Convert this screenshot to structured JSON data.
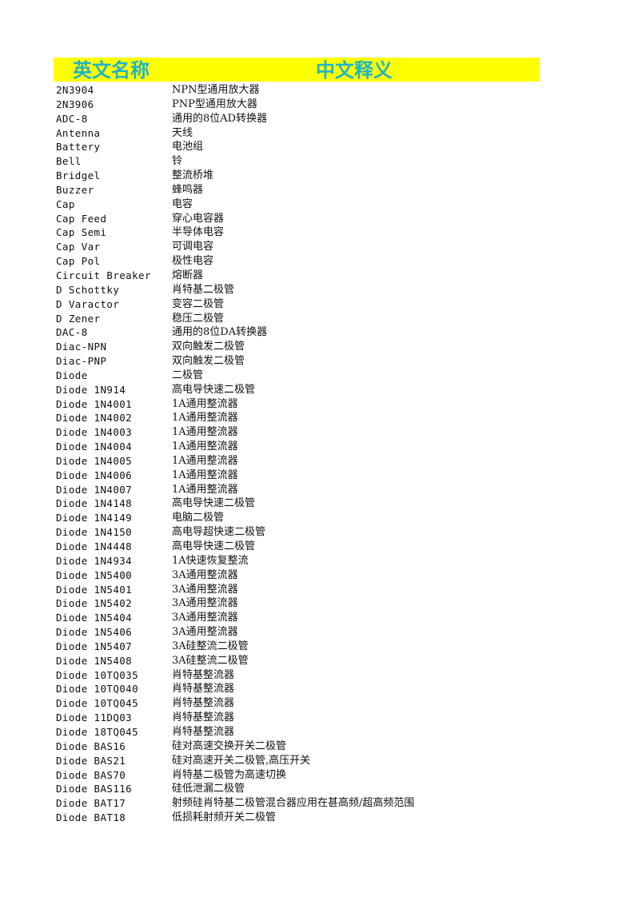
{
  "header": {
    "english_name": "英文名称",
    "chinese_meaning": "中文释义"
  },
  "colors": {
    "header_bg": "#ffff00",
    "header_text": "#1fb3c8"
  },
  "rows": [
    {
      "en": "2N3904",
      "cn": "NPN型通用放大器"
    },
    {
      "en": "2N3906",
      "cn": "PNP型通用放大器"
    },
    {
      "en": "ADC-8",
      "cn": "通用的8位AD转换器"
    },
    {
      "en": "Antenna",
      "cn": "天线"
    },
    {
      "en": "Battery",
      "cn": "电池组"
    },
    {
      "en": "Bell",
      "cn": "铃"
    },
    {
      "en": "Bridgel",
      "cn": "整流桥堆"
    },
    {
      "en": "Buzzer",
      "cn": "蜂鸣器"
    },
    {
      "en": "Cap",
      "cn": "电容"
    },
    {
      "en": "Cap Feed",
      "cn": "穿心电容器"
    },
    {
      "en": "Cap Semi",
      "cn": "半导体电容"
    },
    {
      "en": "Cap Var",
      "cn": "可调电容"
    },
    {
      "en": "Cap Pol",
      "cn": "极性电容"
    },
    {
      "en": "Circuit Breaker",
      "cn": "熔断器"
    },
    {
      "en": "D Schottky",
      "cn": "肖特基二极管"
    },
    {
      "en": "D Varactor",
      "cn": "变容二极管"
    },
    {
      "en": "D Zener",
      "cn": "稳压二极管"
    },
    {
      "en": "DAC-8",
      "cn": "通用的8位DA转换器"
    },
    {
      "en": "Diac-NPN",
      "cn": "双向触发二极管"
    },
    {
      "en": "Diac-PNP",
      "cn": "双向触发二极管"
    },
    {
      "en": "Diode",
      "cn": "二极管"
    },
    {
      "en": "Diode 1N914",
      "cn": "高电导快速二极管"
    },
    {
      "en": "Diode 1N4001",
      "cn": "1A通用整流器"
    },
    {
      "en": "Diode 1N4002",
      "cn": "1A通用整流器"
    },
    {
      "en": "Diode 1N4003",
      "cn": "1A通用整流器"
    },
    {
      "en": "Diode 1N4004",
      "cn": "1A通用整流器"
    },
    {
      "en": "Diode 1N4005",
      "cn": "1A通用整流器"
    },
    {
      "en": "Diode 1N4006",
      "cn": "1A通用整流器"
    },
    {
      "en": "Diode 1N4007",
      "cn": "1A通用整流器"
    },
    {
      "en": "Diode 1N4148",
      "cn": "高电导快速二极管"
    },
    {
      "en": "Diode 1N4149",
      "cn": "电脑二极管"
    },
    {
      "en": "Diode 1N4150",
      "cn": "高电导超快速二极管"
    },
    {
      "en": "Diode 1N4448",
      "cn": "高电导快速二极管"
    },
    {
      "en": "Diode 1N4934",
      "cn": "1A快速恢复整流"
    },
    {
      "en": "Diode 1N5400",
      "cn": "3A通用整流器"
    },
    {
      "en": "Diode 1N5401",
      "cn": "3A通用整流器"
    },
    {
      "en": "Diode 1N5402",
      "cn": "3A通用整流器"
    },
    {
      "en": "Diode 1N5404",
      "cn": "3A通用整流器"
    },
    {
      "en": "Diode 1N5406",
      "cn": "3A通用整流器"
    },
    {
      "en": "Diode 1N5407",
      "cn": "3A硅整流二极管"
    },
    {
      "en": "Diode 1N5408",
      "cn": "3A硅整流二极管"
    },
    {
      "en": "Diode 10TQ035",
      "cn": "肖特基整流器"
    },
    {
      "en": "Diode 10TQ040",
      "cn": "肖特基整流器"
    },
    {
      "en": "Diode 10TQ045",
      "cn": "肖特基整流器"
    },
    {
      "en": "Diode 11DQ03",
      "cn": "肖特基整流器"
    },
    {
      "en": "Diode 18TQ045",
      "cn": "肖特基整流器"
    },
    {
      "en": "Diode BAS16",
      "cn": "硅对高速交换开关二极管"
    },
    {
      "en": "Diode BAS21",
      "cn": "硅对高速开关二极管,高压开关"
    },
    {
      "en": "Diode BAS70",
      "cn": "肖特基二极管为高速切换"
    },
    {
      "en": "Diode BAS116",
      "cn": "硅低泄漏二极管"
    },
    {
      "en": "Diode BAT17",
      "cn": "射频硅肖特基二极管混合器应用在甚高频/超高频范围"
    },
    {
      "en": "Diode BAT18",
      "cn": "低损耗射频开关二极管"
    }
  ]
}
